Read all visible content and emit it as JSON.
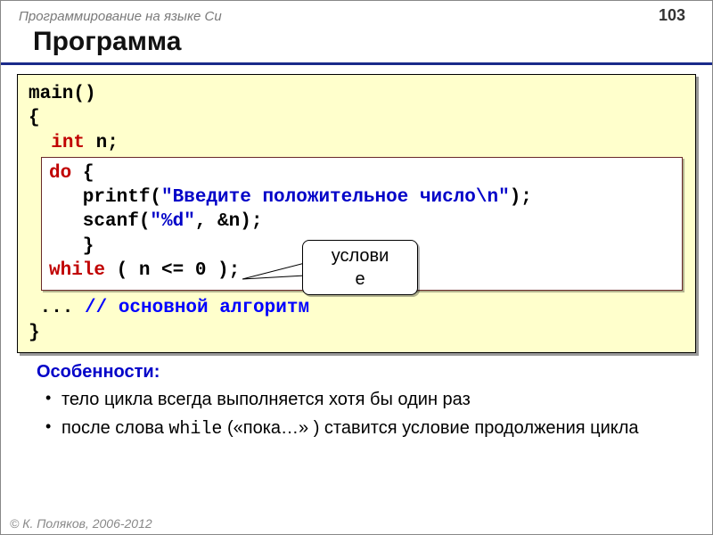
{
  "header": {
    "course": "Программирование на языке Си",
    "page": "103"
  },
  "title": "Программа",
  "code": {
    "l1": "main()",
    "l2": "{",
    "l3_kw": "int",
    "l3_rest": " n;",
    "box": {
      "do": "do",
      "brace_open": " {",
      "printf1": "   printf(",
      "printf_str": "\"Введите положительное число\\n\"",
      "printf2": ");",
      "scanf1": "   scanf(",
      "scanf_str": "\"%d\"",
      "scanf2": ", &n);",
      "brace_close": "   }",
      "while": "while",
      "cond": " ( n <= 0 );"
    },
    "dots": " ... ",
    "comment": "// основной алгоритм",
    "end": "}"
  },
  "callout": {
    "line1": "услови",
    "line2": "е"
  },
  "features": {
    "heading": "Особенности:",
    "items": [
      {
        "text": "тело цикла всегда выполняется хотя бы один раз"
      },
      {
        "pre": "после слова ",
        "mono": "while",
        "post": " («пока…» ) ставится условие продолжения цикла"
      }
    ]
  },
  "footer": "© К. Поляков, 2006-2012"
}
